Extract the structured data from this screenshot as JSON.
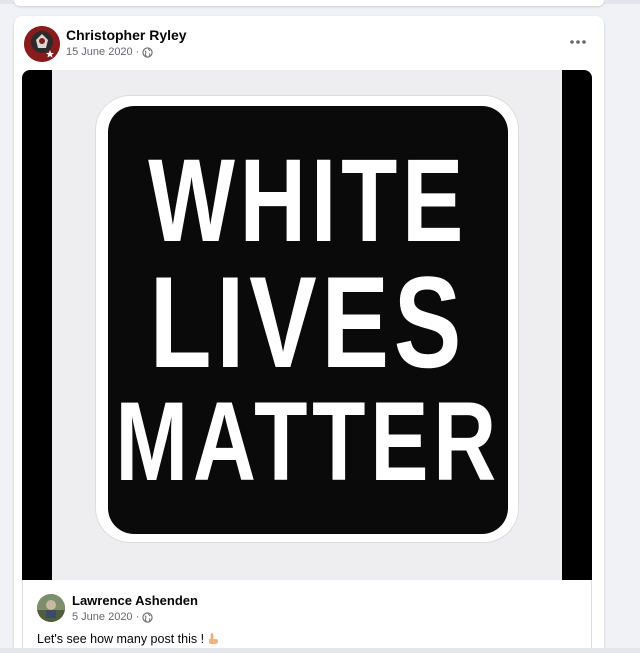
{
  "post": {
    "author": "Christopher Ryley",
    "date": "15 June 2020",
    "separator": "·",
    "privacy_icon": "globe-icon",
    "more_icon": "more-horizontal-icon"
  },
  "image": {
    "lines": [
      "WHITE",
      "LIVES",
      "MATTER"
    ]
  },
  "shared_post": {
    "author": "Lawrence Ashenden",
    "date": "5 June 2020",
    "separator": "·",
    "privacy_icon": "globe-icon",
    "text": "Let's see how many post this !",
    "emoji_icon": "pointing-hand-icon"
  },
  "colors": {
    "background": "#f0f2f5",
    "card": "#ffffff",
    "meta_text": "#65676b",
    "primary_text": "#050505"
  }
}
